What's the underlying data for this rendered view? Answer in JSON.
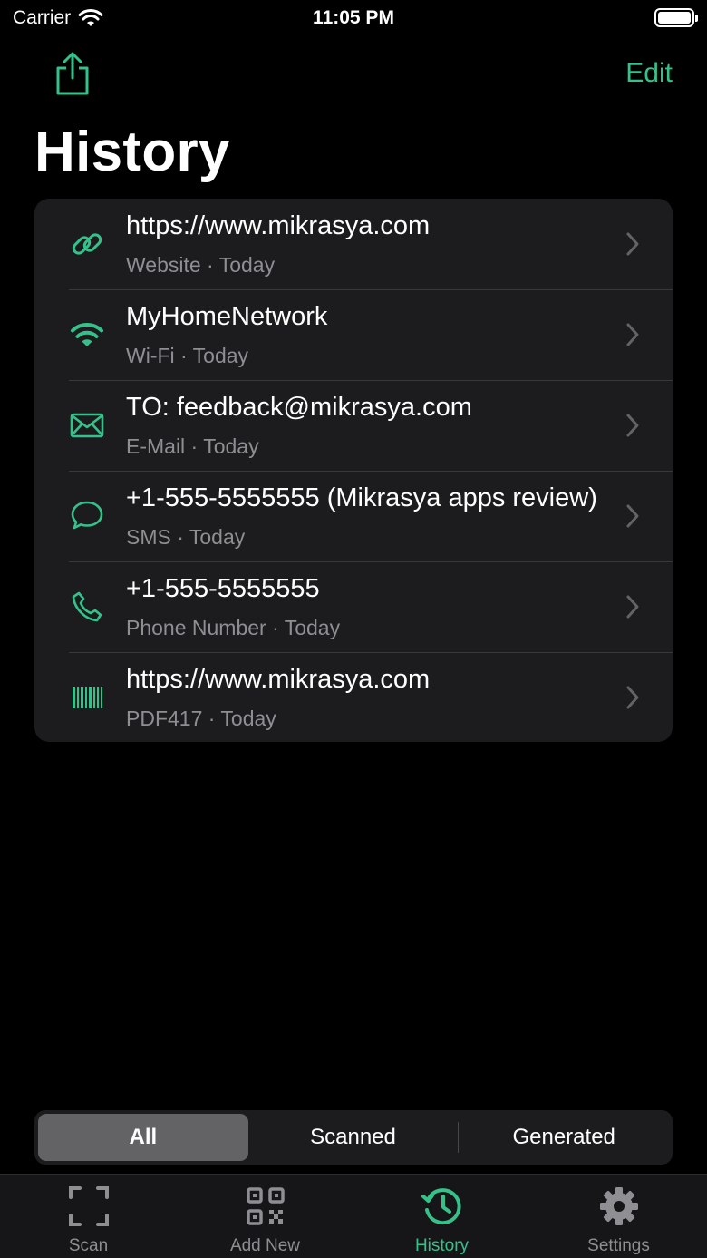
{
  "status_bar": {
    "carrier": "Carrier",
    "time": "11:05 PM"
  },
  "nav": {
    "edit_label": "Edit"
  },
  "page_title": "History",
  "accent_color": "#34c28a",
  "history": [
    {
      "icon": "link-icon",
      "title": "https://www.mikrasya.com",
      "subtitle": "Website · Today"
    },
    {
      "icon": "wifi-icon",
      "title": "MyHomeNetwork",
      "subtitle": "Wi-Fi · Today"
    },
    {
      "icon": "envelope-icon",
      "title": "TO: feedback@mikrasya.com",
      "subtitle": "E-Mail · Today"
    },
    {
      "icon": "message-bubble-icon",
      "title": "+1-555-5555555 (Mikrasya apps review)",
      "subtitle": "SMS · Today"
    },
    {
      "icon": "phone-icon",
      "title": "+1-555-5555555",
      "subtitle": "Phone Number · Today"
    },
    {
      "icon": "barcode-icon",
      "title": "https://www.mikrasya.com",
      "subtitle": "PDF417 · Today"
    }
  ],
  "filter": {
    "options": [
      "All",
      "Scanned",
      "Generated"
    ],
    "selected": "All"
  },
  "tabs": [
    {
      "icon": "scan-frame-icon",
      "label": "Scan"
    },
    {
      "icon": "qr-code-icon",
      "label": "Add New"
    },
    {
      "icon": "history-clock-icon",
      "label": "History",
      "active": true
    },
    {
      "icon": "gear-icon",
      "label": "Settings"
    }
  ]
}
